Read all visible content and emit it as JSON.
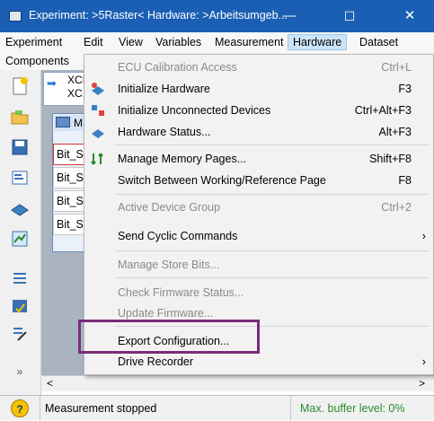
{
  "window": {
    "title": "Experiment: >5Raster< Hardware: >Arbeitsumgeb...",
    "minimize": "—",
    "maximize": "☐",
    "close": "✕"
  },
  "menubar": {
    "items": [
      "Experiment",
      "Edit",
      "View",
      "Variables",
      "Measurement",
      "Hardware",
      "Dataset"
    ],
    "row2": "Components"
  },
  "tree": {
    "item1": "XCI",
    "item2": "XC."
  },
  "inner_window": {
    "title": "M",
    "cells": [
      "Bit_S",
      "Bit_S",
      "Bit_S",
      "Bit_S"
    ]
  },
  "toolbar": {
    "overflow": "»"
  },
  "hscroll": {
    "left": "<",
    "right": ">"
  },
  "hardware_menu": {
    "items": [
      {
        "label": "ECU Calibration Access",
        "shortcut": "Ctrl+L",
        "disabled": true,
        "icon": ""
      },
      {
        "label": "Initialize Hardware",
        "shortcut": "F3",
        "disabled": false,
        "icon": "init-hardware-icon"
      },
      {
        "label": "Initialize Unconnected Devices",
        "shortcut": "Ctrl+Alt+F3",
        "disabled": false,
        "icon": "unconnected-devices-icon"
      },
      {
        "label": "Hardware Status...",
        "shortcut": "Alt+F3",
        "disabled": false,
        "icon": "hardware-status-icon"
      },
      {
        "label": "Manage Memory Pages...",
        "shortcut": "Shift+F8",
        "disabled": false,
        "icon": "memory-pages-icon"
      },
      {
        "label": "Switch Between Working/Reference Page",
        "shortcut": "F8",
        "disabled": false,
        "icon": ""
      },
      {
        "label": "Active Device Group",
        "shortcut": "Ctrl+2",
        "disabled": true,
        "icon": ""
      },
      {
        "label": "Send Cyclic Commands",
        "shortcut": "",
        "submenu": true,
        "disabled": false,
        "icon": ""
      },
      {
        "label": "Manage Store Bits...",
        "shortcut": "",
        "disabled": true,
        "icon": ""
      },
      {
        "label": "Check Firmware Status...",
        "shortcut": "",
        "disabled": true,
        "icon": ""
      },
      {
        "label": "Update Firmware...",
        "shortcut": "",
        "disabled": true,
        "icon": ""
      },
      {
        "label": "Export Configuration...",
        "shortcut": "",
        "disabled": false,
        "icon": ""
      },
      {
        "label": "Drive Recorder",
        "shortcut": "",
        "submenu": true,
        "disabled": false,
        "icon": ""
      }
    ],
    "submenu_arrow": "›"
  },
  "statusbar": {
    "status": "Measurement stopped",
    "buffer": "Max. buffer level: 0%"
  },
  "colors": {
    "titlebar": "#1a5fb4",
    "menu_hover": "#cce4f7",
    "highlight_frame": "#7a2c7a",
    "buffer_text": "#2e8b2e"
  }
}
